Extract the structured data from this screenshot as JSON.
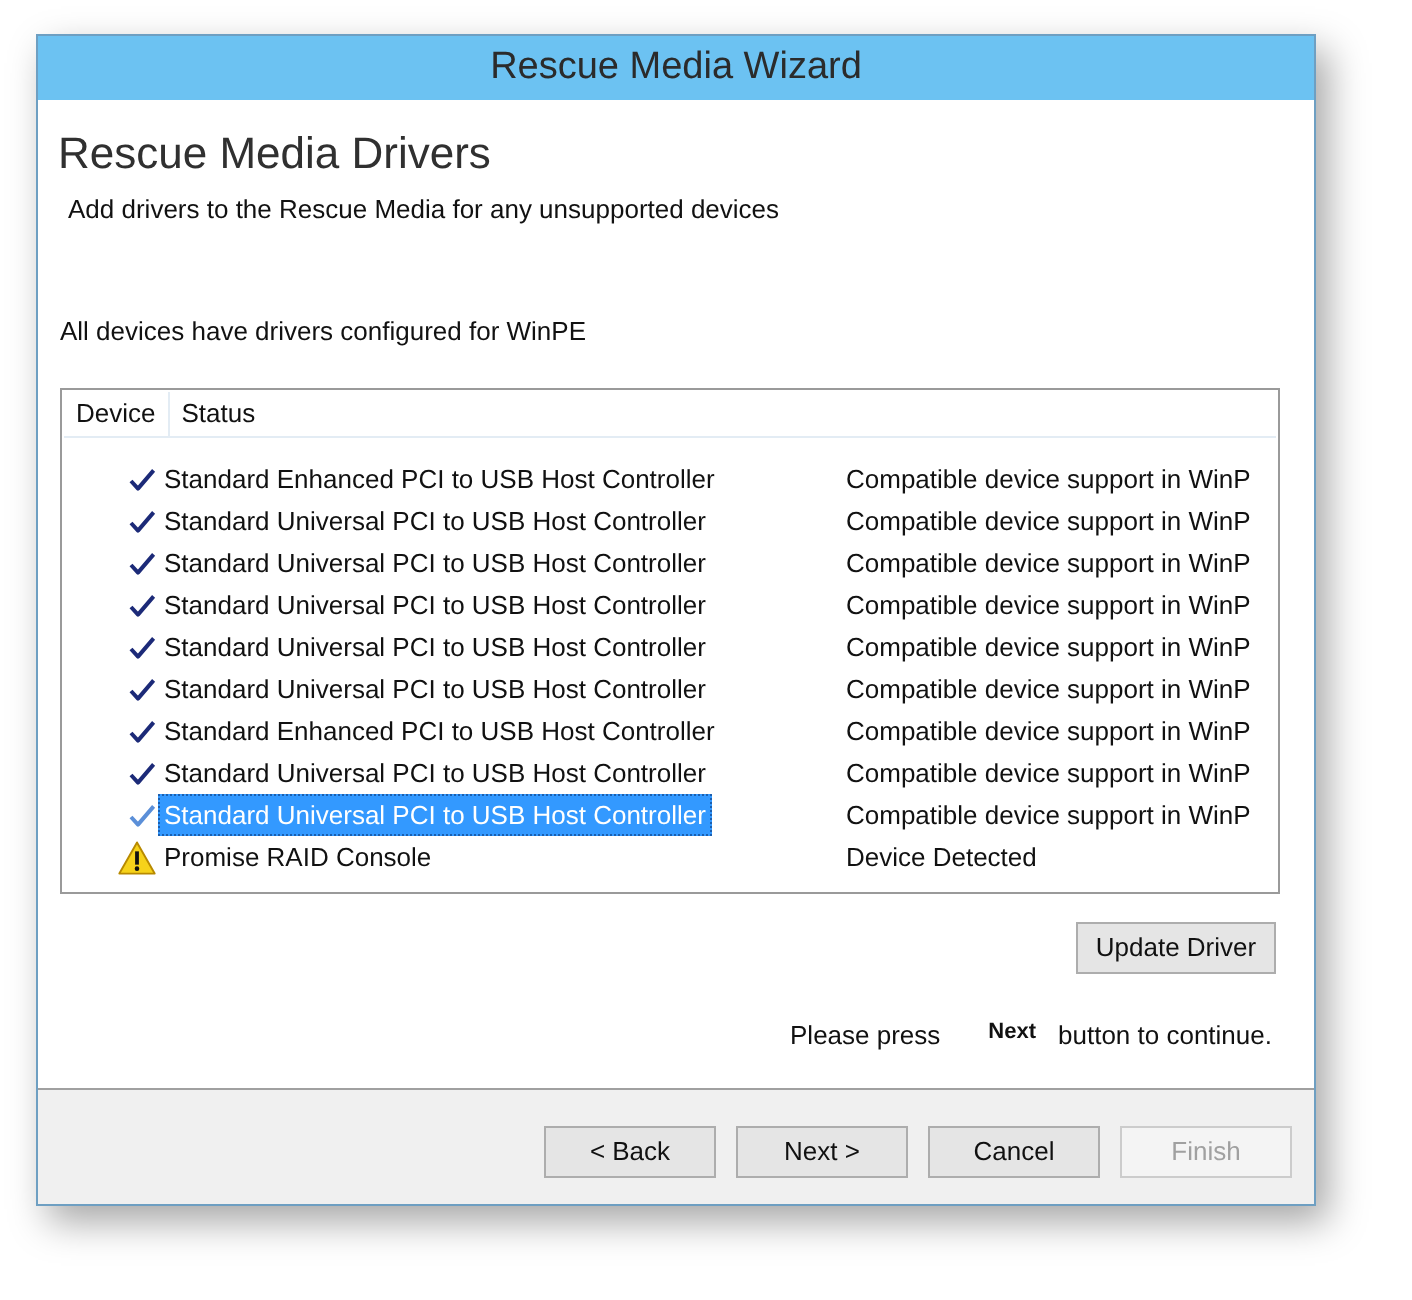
{
  "window": {
    "title": "Rescue Media Wizard"
  },
  "page": {
    "heading": "Rescue Media Drivers",
    "subtitle": "Add drivers to the Rescue Media for any unsupported devices",
    "summary": "All devices have drivers configured for WinPE"
  },
  "device_list": {
    "columns": [
      "Device",
      "Status"
    ],
    "rows": [
      {
        "kind": "check",
        "device": "Standard Enhanced PCI to USB Host Controller",
        "status": "Compatible device support in WinP",
        "selected": false
      },
      {
        "kind": "check",
        "device": "Standard Universal PCI to USB Host Controller",
        "status": "Compatible device support in WinP",
        "selected": false
      },
      {
        "kind": "check",
        "device": "Standard Universal PCI to USB Host Controller",
        "status": "Compatible device support in WinP",
        "selected": false
      },
      {
        "kind": "check",
        "device": "Standard Universal PCI to USB Host Controller",
        "status": "Compatible device support in WinP",
        "selected": false
      },
      {
        "kind": "check",
        "device": "Standard Universal PCI to USB Host Controller",
        "status": "Compatible device support in WinP",
        "selected": false
      },
      {
        "kind": "check",
        "device": "Standard Universal PCI to USB Host Controller",
        "status": "Compatible device support in WinP",
        "selected": false
      },
      {
        "kind": "check",
        "device": "Standard Enhanced PCI to USB Host Controller",
        "status": "Compatible device support in WinP",
        "selected": false
      },
      {
        "kind": "check",
        "device": "Standard Universal PCI to USB Host Controller",
        "status": "Compatible device support in WinP",
        "selected": false
      },
      {
        "kind": "check",
        "device": "Standard Universal PCI to USB Host Controller",
        "status": "Compatible device support in WinP",
        "selected": true
      },
      {
        "kind": "warning",
        "device": "Promise RAID Console",
        "status": "Device Detected",
        "selected": false
      }
    ]
  },
  "update_button": "Update Driver",
  "hint": {
    "before": "Please press",
    "key": "Next",
    "after": "button to continue."
  },
  "buttons": [
    {
      "label": "< Back",
      "disabled": false
    },
    {
      "label": "Next >",
      "disabled": false
    },
    {
      "label": "Cancel",
      "disabled": false
    },
    {
      "label": "Finish",
      "disabled": true
    }
  ]
}
